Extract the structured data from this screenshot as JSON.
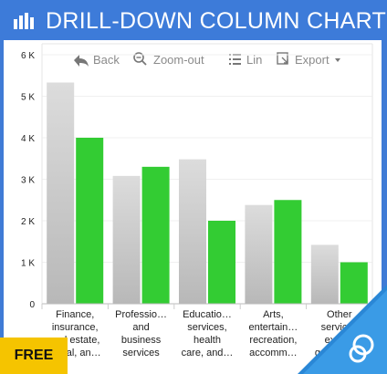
{
  "header": {
    "title": "DRILL-DOWN COLUMN CHART"
  },
  "toolbar": {
    "back_label": "Back",
    "zoomout_label": "Zoom-out",
    "line_label": "Lin",
    "export_label": "Export"
  },
  "badge": {
    "label": "FREE"
  },
  "colors": {
    "header_bg": "#3d7bd9",
    "series_gray_top": "#dcdcdc",
    "series_gray_bottom": "#b8b8b8",
    "series_green": "#33cc33",
    "badge_bg": "#f5c400"
  },
  "chart_data": {
    "type": "bar",
    "ylim": [
      0,
      6000
    ],
    "yticks": [
      "0",
      "1 K",
      "2 K",
      "3 K",
      "4 K",
      "5 K",
      "6 K"
    ],
    "categories": [
      [
        "Finance,",
        "insurance,",
        "real estate,",
        "rental, an…"
      ],
      [
        "Professio…",
        "and",
        "business",
        "services"
      ],
      [
        "Educatio…",
        "services,",
        "health",
        "care, and…"
      ],
      [
        "Arts,",
        "entertain…",
        "recreation,",
        "accomm…"
      ],
      [
        "Other",
        "services",
        "except",
        "governm…"
      ]
    ],
    "series": [
      {
        "values": [
          5330,
          3080,
          3480,
          2380,
          1420
        ]
      },
      {
        "values": [
          4000,
          3300,
          2000,
          2500,
          1000
        ]
      }
    ],
    "grid": true,
    "legend": "none"
  }
}
